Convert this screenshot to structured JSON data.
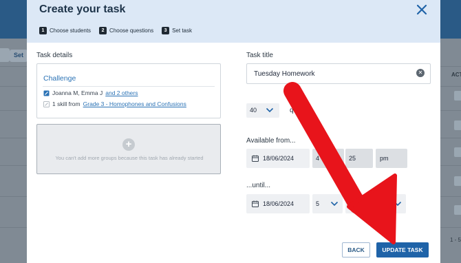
{
  "background": {
    "set_button_label": "Set",
    "actions_header": "ACT",
    "pagination": "1 - 5"
  },
  "modal": {
    "title": "Create your task",
    "steps": [
      {
        "num": "1",
        "label": "Choose students"
      },
      {
        "num": "2",
        "label": "Choose questions"
      },
      {
        "num": "3",
        "label": "Set task"
      }
    ],
    "task_details": {
      "label": "Task details",
      "group_name": "Challenge",
      "students_text": "Joanna M, Emma J",
      "students_link": "and 2 others",
      "skill_prefix": "1 skill from",
      "skill_link": "Grade 3 - Homophones and Confusions",
      "add_group_message": "You can't add more groups because this task has already started"
    },
    "task_title": {
      "label": "Task title",
      "value": "Tuesday Homework"
    },
    "questions": {
      "count": "40",
      "suffix": "quest"
    },
    "available_from": {
      "label": "Available from...",
      "date": "18/06/2024",
      "hour": "4",
      "minute": "25",
      "ampm": "pm"
    },
    "until": {
      "label": "...until...",
      "date": "18/06/2024",
      "hour": "5",
      "minute": "25"
    },
    "buttons": {
      "back": "BACK",
      "update": "UPDATE TASK"
    }
  },
  "colors": {
    "header_bg": "#2a5a86",
    "modal_head_bg": "#dce8f6",
    "primary": "#1f63a8",
    "link": "#2a72b5",
    "annotation_arrow": "#e8141b"
  }
}
